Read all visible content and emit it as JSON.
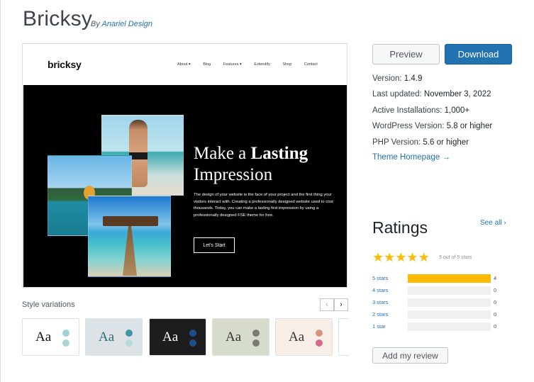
{
  "theme": {
    "title": "Bricksy",
    "by_prefix": "By",
    "author": "Anariel Design"
  },
  "preview_site": {
    "logo": "bricksy",
    "nav": [
      "About ▾",
      "Blog",
      "Features ▾",
      "Extendify",
      "Shop",
      "Contact"
    ],
    "hero_heading_line1_plain": "Make a ",
    "hero_heading_line1_bold": "Lasting",
    "hero_heading_line2": "Impression",
    "hero_paragraph": "The design of your website is the face of your project and the first thing your visitors interact with. Creating a professionally designed website used to cost thousands. Today, you can make a lasting first impression by using a professionally designed FSE theme for free.",
    "hero_button": "Let's Start"
  },
  "style_variations": {
    "label": "Style variations",
    "prev_icon": "‹",
    "next_icon": "›",
    "items": [
      {
        "text": "Aa",
        "bg": "#ffffff",
        "fg": "#111111",
        "dot1": "#9fcfd8",
        "dot2": "#a8d8d0"
      },
      {
        "text": "Aa",
        "bg": "#dde2e6",
        "fg": "#2b6b78",
        "dot1": "#3f95a6",
        "dot2": "#b2dcd8"
      },
      {
        "text": "Aa",
        "bg": "#1d1d1f",
        "fg": "#ffffff",
        "dot1": "#1b4f8a",
        "dot2": "#1b4f8a"
      },
      {
        "text": "Aa",
        "bg": "#d6dccc",
        "fg": "#333333",
        "dot1": "#7a7a72",
        "dot2": "#7a7a72"
      },
      {
        "text": "Aa",
        "bg": "#f7efe7",
        "fg": "#333333",
        "dot1": "#d9917f",
        "dot2": "#d46b8a"
      }
    ]
  },
  "actions": {
    "preview": "Preview",
    "download": "Download"
  },
  "meta": {
    "version_label": "Version:",
    "version": "1.4.9",
    "updated_label": "Last updated:",
    "updated": "November 3, 2022",
    "installs_label": "Active Installations:",
    "installs": "1,000+",
    "wp_label": "WordPress Version:",
    "wp": "5.8 or higher",
    "php_label": "PHP Version:",
    "php": "5.6 or higher",
    "homepage": "Theme Homepage →"
  },
  "ratings": {
    "title": "Ratings",
    "see_all": "See all ›",
    "stars_icon": "★",
    "stars_text": "5 out of 5 stars",
    "rows": [
      {
        "label": "5 stars",
        "count": "4",
        "fraction": 1.0
      },
      {
        "label": "4 stars",
        "count": "0",
        "fraction": 0
      },
      {
        "label": "3 stars",
        "count": "0",
        "fraction": 0
      },
      {
        "label": "2 stars",
        "count": "0",
        "fraction": 0
      },
      {
        "label": "1 star",
        "count": "0",
        "fraction": 0
      }
    ],
    "add_review": "Add my review"
  },
  "colors": {
    "accent": "#2271b1",
    "star": "#ffb900"
  }
}
